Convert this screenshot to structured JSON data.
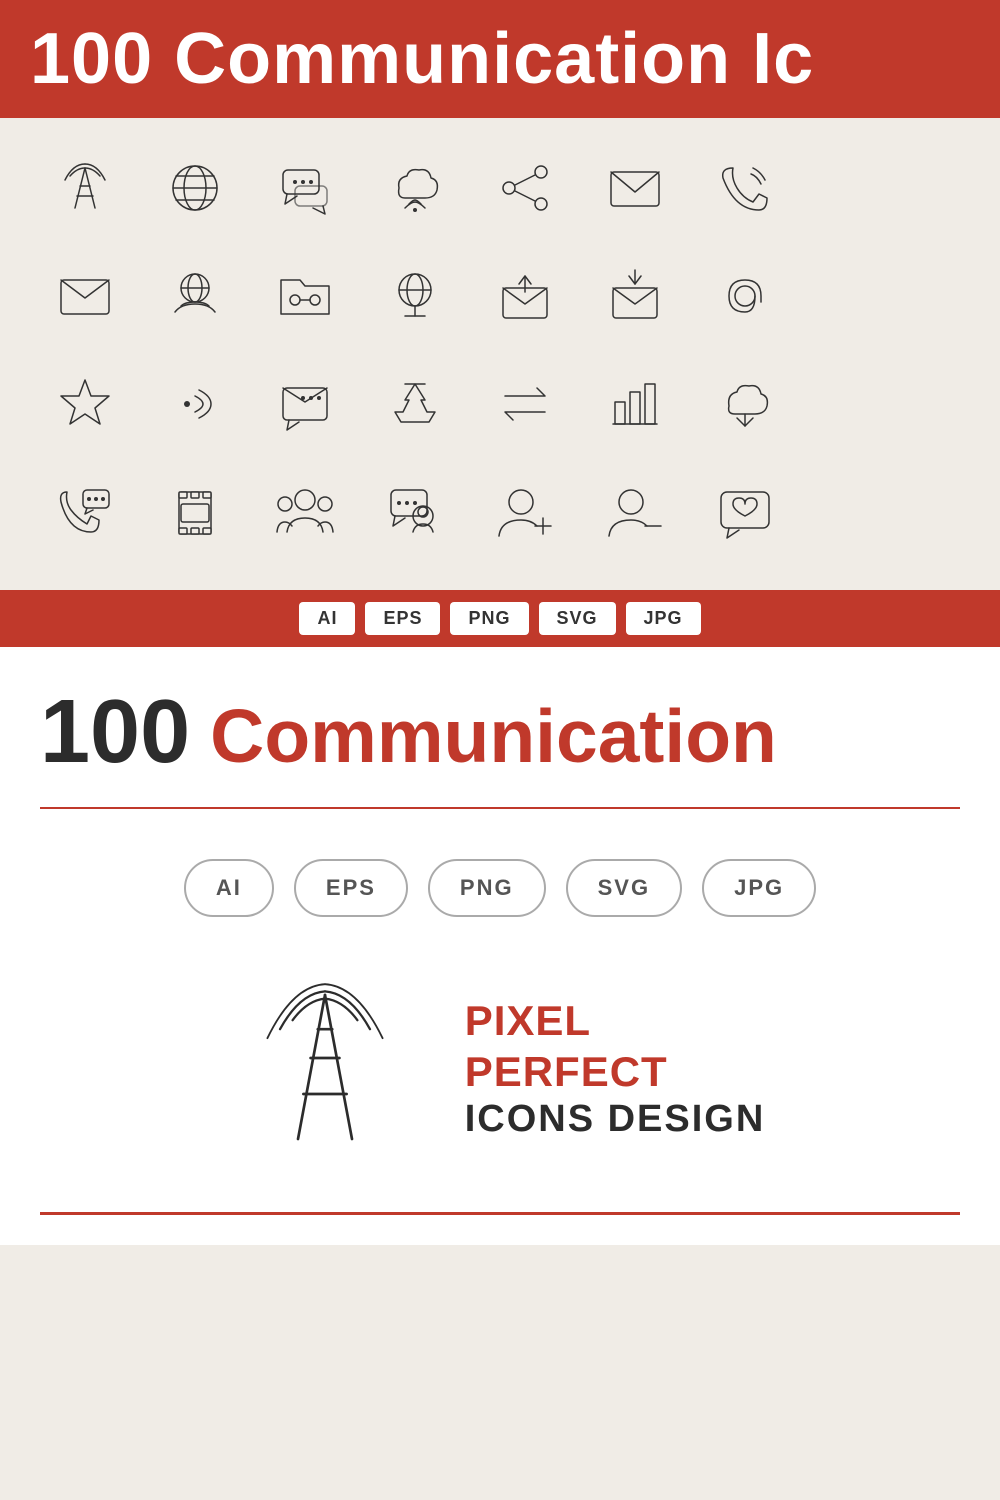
{
  "banner": {
    "text": "100 Communication Ic"
  },
  "format_strip": {
    "badges": [
      "AI",
      "EPS",
      "PNG",
      "SVG",
      "JPG"
    ]
  },
  "lower": {
    "title_number": "100",
    "title_text": "Communication",
    "format_badges": [
      "AI",
      "EPS",
      "PNG",
      "SVG",
      "JPG"
    ],
    "pixel_line1": "PIXEL",
    "pixel_line2": "PERFECT",
    "pixel_line3": "ICONS DESIGN"
  }
}
